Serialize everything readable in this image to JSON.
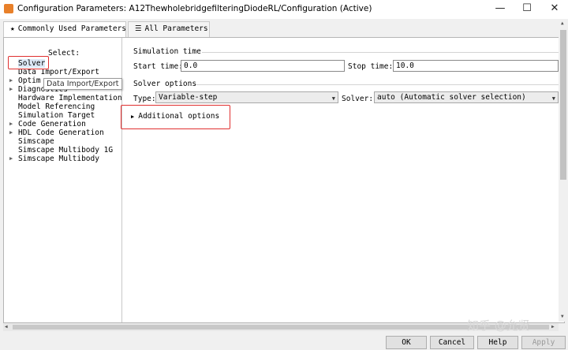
{
  "window": {
    "title": "Configuration Parameters: A12ThewholebridgefilteringDiodeRL/Configuration (Active)",
    "minimize_glyph": "—",
    "maximize_glyph": "☐",
    "close_glyph": "✕"
  },
  "tabs": [
    {
      "icon": "★",
      "label": "Commonly Used Parameters"
    },
    {
      "icon": "☰",
      "label": "All Parameters"
    }
  ],
  "tree": {
    "select_label": "Select:",
    "items": [
      {
        "label": "Solver",
        "expandable": false
      },
      {
        "label": "Data Import/Export",
        "expandable": false
      },
      {
        "label": "Optim",
        "expandable": true
      },
      {
        "label": "Diagnostics",
        "expandable": true
      },
      {
        "label": "Hardware Implementation",
        "expandable": false
      },
      {
        "label": "Model Referencing",
        "expandable": false
      },
      {
        "label": "Simulation Target",
        "expandable": false
      },
      {
        "label": "Code Generation",
        "expandable": true
      },
      {
        "label": "HDL Code Generation",
        "expandable": true
      },
      {
        "label": "Simscape",
        "expandable": false
      },
      {
        "label": "Simscape Multibody 1G",
        "expandable": false
      },
      {
        "label": "Simscape Multibody",
        "expandable": true
      }
    ],
    "tooltip": "Data Import/Export"
  },
  "simulation_time": {
    "title": "Simulation time",
    "start_label": "Start time:",
    "start_value": "0.0",
    "stop_label": "Stop time:",
    "stop_value": "10.0"
  },
  "solver_options": {
    "title": "Solver options",
    "type_label": "Type:",
    "type_value": "Variable-step",
    "solver_label": "Solver:",
    "solver_value": "auto (Automatic solver selection)",
    "additional_options": "Additional options"
  },
  "buttons": {
    "ok": "OK",
    "cancel": "Cancel",
    "help": "Help",
    "apply": "Apply"
  },
  "watermark": "知乎 @允贤",
  "colors": {
    "highlight_box": "#e03030",
    "selected_row": "#dde9f6",
    "disabled_text": "#9a9a9a"
  }
}
